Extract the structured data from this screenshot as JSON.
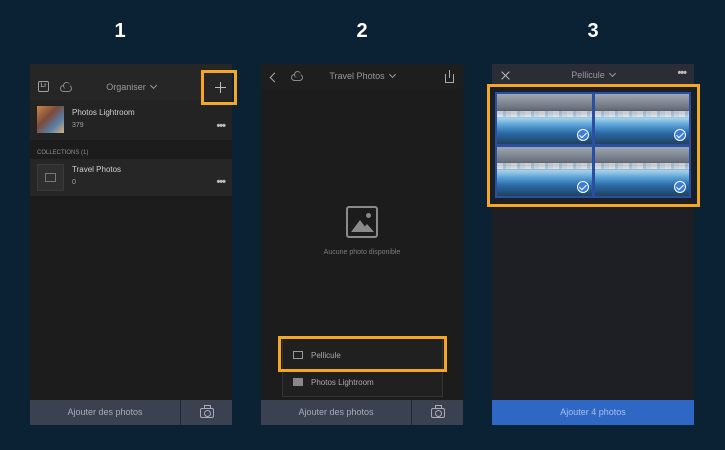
{
  "steps": [
    "1",
    "2",
    "3"
  ],
  "screen1": {
    "header_title": "Organiser",
    "logo_text": "Lr",
    "all_photos": {
      "name": "Photos Lightroom",
      "count": "379"
    },
    "collections_label": "COLLECTIONS (1)",
    "collection": {
      "name": "Travel Photos",
      "count": "0"
    },
    "more_label": "•••",
    "add_photos_label": "Ajouter des photos"
  },
  "screen2": {
    "header_title": "Travel Photos",
    "empty_text": "Aucune photo disponible",
    "menu": [
      {
        "label": "Pellicule",
        "icon": "image-icon"
      },
      {
        "label": "Photos Lightroom",
        "icon": "library-icon"
      }
    ],
    "add_photos_label": "Ajouter des photos"
  },
  "screen3": {
    "header_title": "Pellicule",
    "more_label": "•••",
    "photo_count_selected": 4,
    "add_button_label": "Ajouter 4 photos"
  },
  "colors": {
    "background": "#0b2234",
    "highlight": "#f5a623",
    "accent_blue": "#2f67c5"
  }
}
